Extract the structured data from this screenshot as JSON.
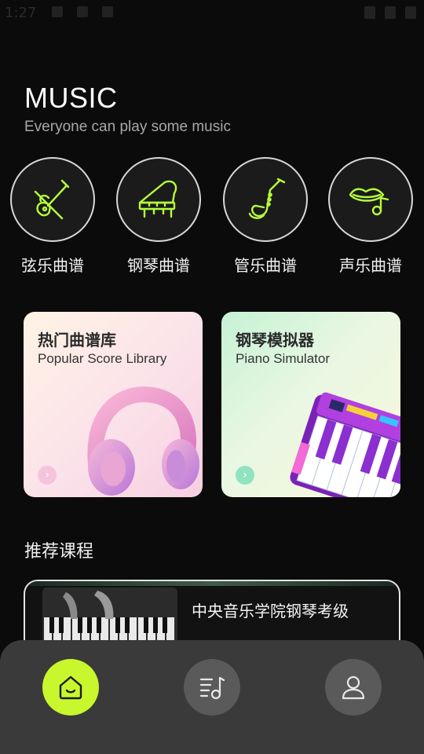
{
  "status": {
    "time": "1:27"
  },
  "header": {
    "title": "MUSIC",
    "subtitle": "Everyone can play some music"
  },
  "categories": [
    {
      "label": "弦乐曲谱",
      "icon": "violin-icon"
    },
    {
      "label": "钢琴曲谱",
      "icon": "grand-piano-icon"
    },
    {
      "label": "管乐曲谱",
      "icon": "saxophone-icon"
    },
    {
      "label": "声乐曲谱",
      "icon": "lips-note-icon"
    }
  ],
  "cards": [
    {
      "title": "热门曲谱库",
      "subtitle": "Popular Score Library",
      "art": "headphones-image"
    },
    {
      "title": "钢琴模拟器",
      "subtitle": "Piano Simulator",
      "art": "keyboard-image"
    }
  ],
  "recommend": {
    "section_title": "推荐课程",
    "course_title": "中央音乐学院钢琴考级"
  },
  "tabbar": {
    "items": [
      {
        "icon": "home-icon",
        "active": true
      },
      {
        "icon": "music-list-icon",
        "active": false
      },
      {
        "icon": "user-icon",
        "active": false
      }
    ]
  },
  "colors": {
    "accent": "#c7f72c",
    "neon_green": "#b6ff3b",
    "background": "#0b0b0b",
    "tabbar": "#3a3a3a"
  }
}
